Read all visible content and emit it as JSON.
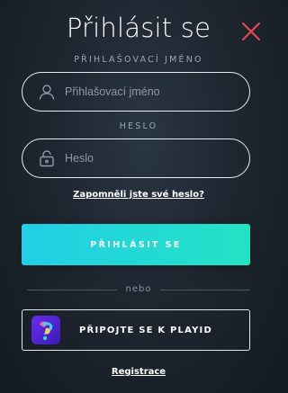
{
  "title": "Přihlásit se",
  "username": {
    "label": "PŘIHLAŠOVACÍ JMÉNO",
    "placeholder": "Přihlašovací jméno",
    "value": ""
  },
  "password": {
    "label": "HESLO",
    "placeholder": "Heslo",
    "value": ""
  },
  "forgot_password": "Zapomněli jste své heslo?",
  "login_button": "PŘIHLÁSIT SE",
  "divider_text": "nebo",
  "playid_button": "PŘIPOJTE SE K PLAYID",
  "register_link": "Registrace",
  "colors": {
    "close": "#e8484f",
    "accent_start": "#22cfe6",
    "accent_end": "#23e2c4"
  }
}
